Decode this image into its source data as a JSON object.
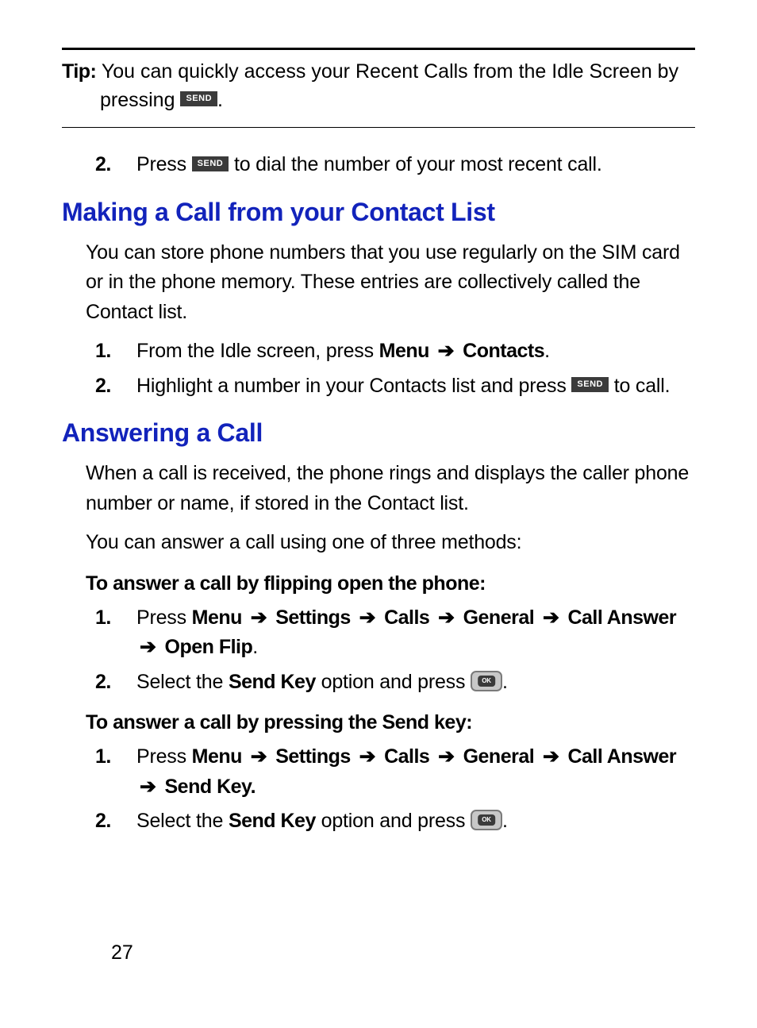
{
  "tip": {
    "label": "Tip:",
    "text1": " You can quickly access your Recent Calls from the Idle Screen by",
    "text2_a": "pressing ",
    "send_key": "SEND",
    "text2_b": "."
  },
  "step2_top": {
    "num": "2.",
    "a": "Press ",
    "send_key": "SEND",
    "b": " to dial the number of your most recent call."
  },
  "section1": {
    "heading": "Making a Call from your Contact List",
    "para": "You can store phone numbers that you use regularly on the SIM card or in the phone memory. These entries are collectively called the Contact list.",
    "items": [
      {
        "num": "1.",
        "a": "From the Idle screen, press ",
        "menu": "Menu",
        "arrow": "➔",
        "contacts": "Contacts",
        "b": "."
      },
      {
        "num": "2.",
        "a": "Highlight a number in your Contacts list and press ",
        "send_key": "SEND",
        "b": " to call."
      }
    ]
  },
  "section2": {
    "heading": "Answering a Call",
    "para1": "When a call is received, the phone rings and displays the caller phone number or name, if stored in the Contact list.",
    "para2": "You can answer a call using one of three methods:",
    "sub1": "To answer a call by flipping open the phone:",
    "sub1_items": [
      {
        "num": "1.",
        "a": "Press ",
        "path": [
          "Menu",
          "Settings",
          "Calls",
          "General",
          "Call Answer",
          "Open Flip"
        ],
        "arrow": "➔",
        "b": "."
      },
      {
        "num": "2.",
        "a": "Select the ",
        "key": "Send Key",
        "b": " option and press ",
        "ok": "OK",
        "c": "."
      }
    ],
    "sub2": "To answer a call by pressing the Send key:",
    "sub2_items": [
      {
        "num": "1.",
        "a": "Press ",
        "path": [
          "Menu",
          "Settings",
          "Calls",
          "General",
          "Call Answer",
          "Send Key."
        ],
        "arrow": "➔",
        "b": ""
      },
      {
        "num": "2.",
        "a": "Select the ",
        "key": "Send Key",
        "b": " option and press ",
        "ok": "OK",
        "c": "."
      }
    ]
  },
  "page_number": "27"
}
